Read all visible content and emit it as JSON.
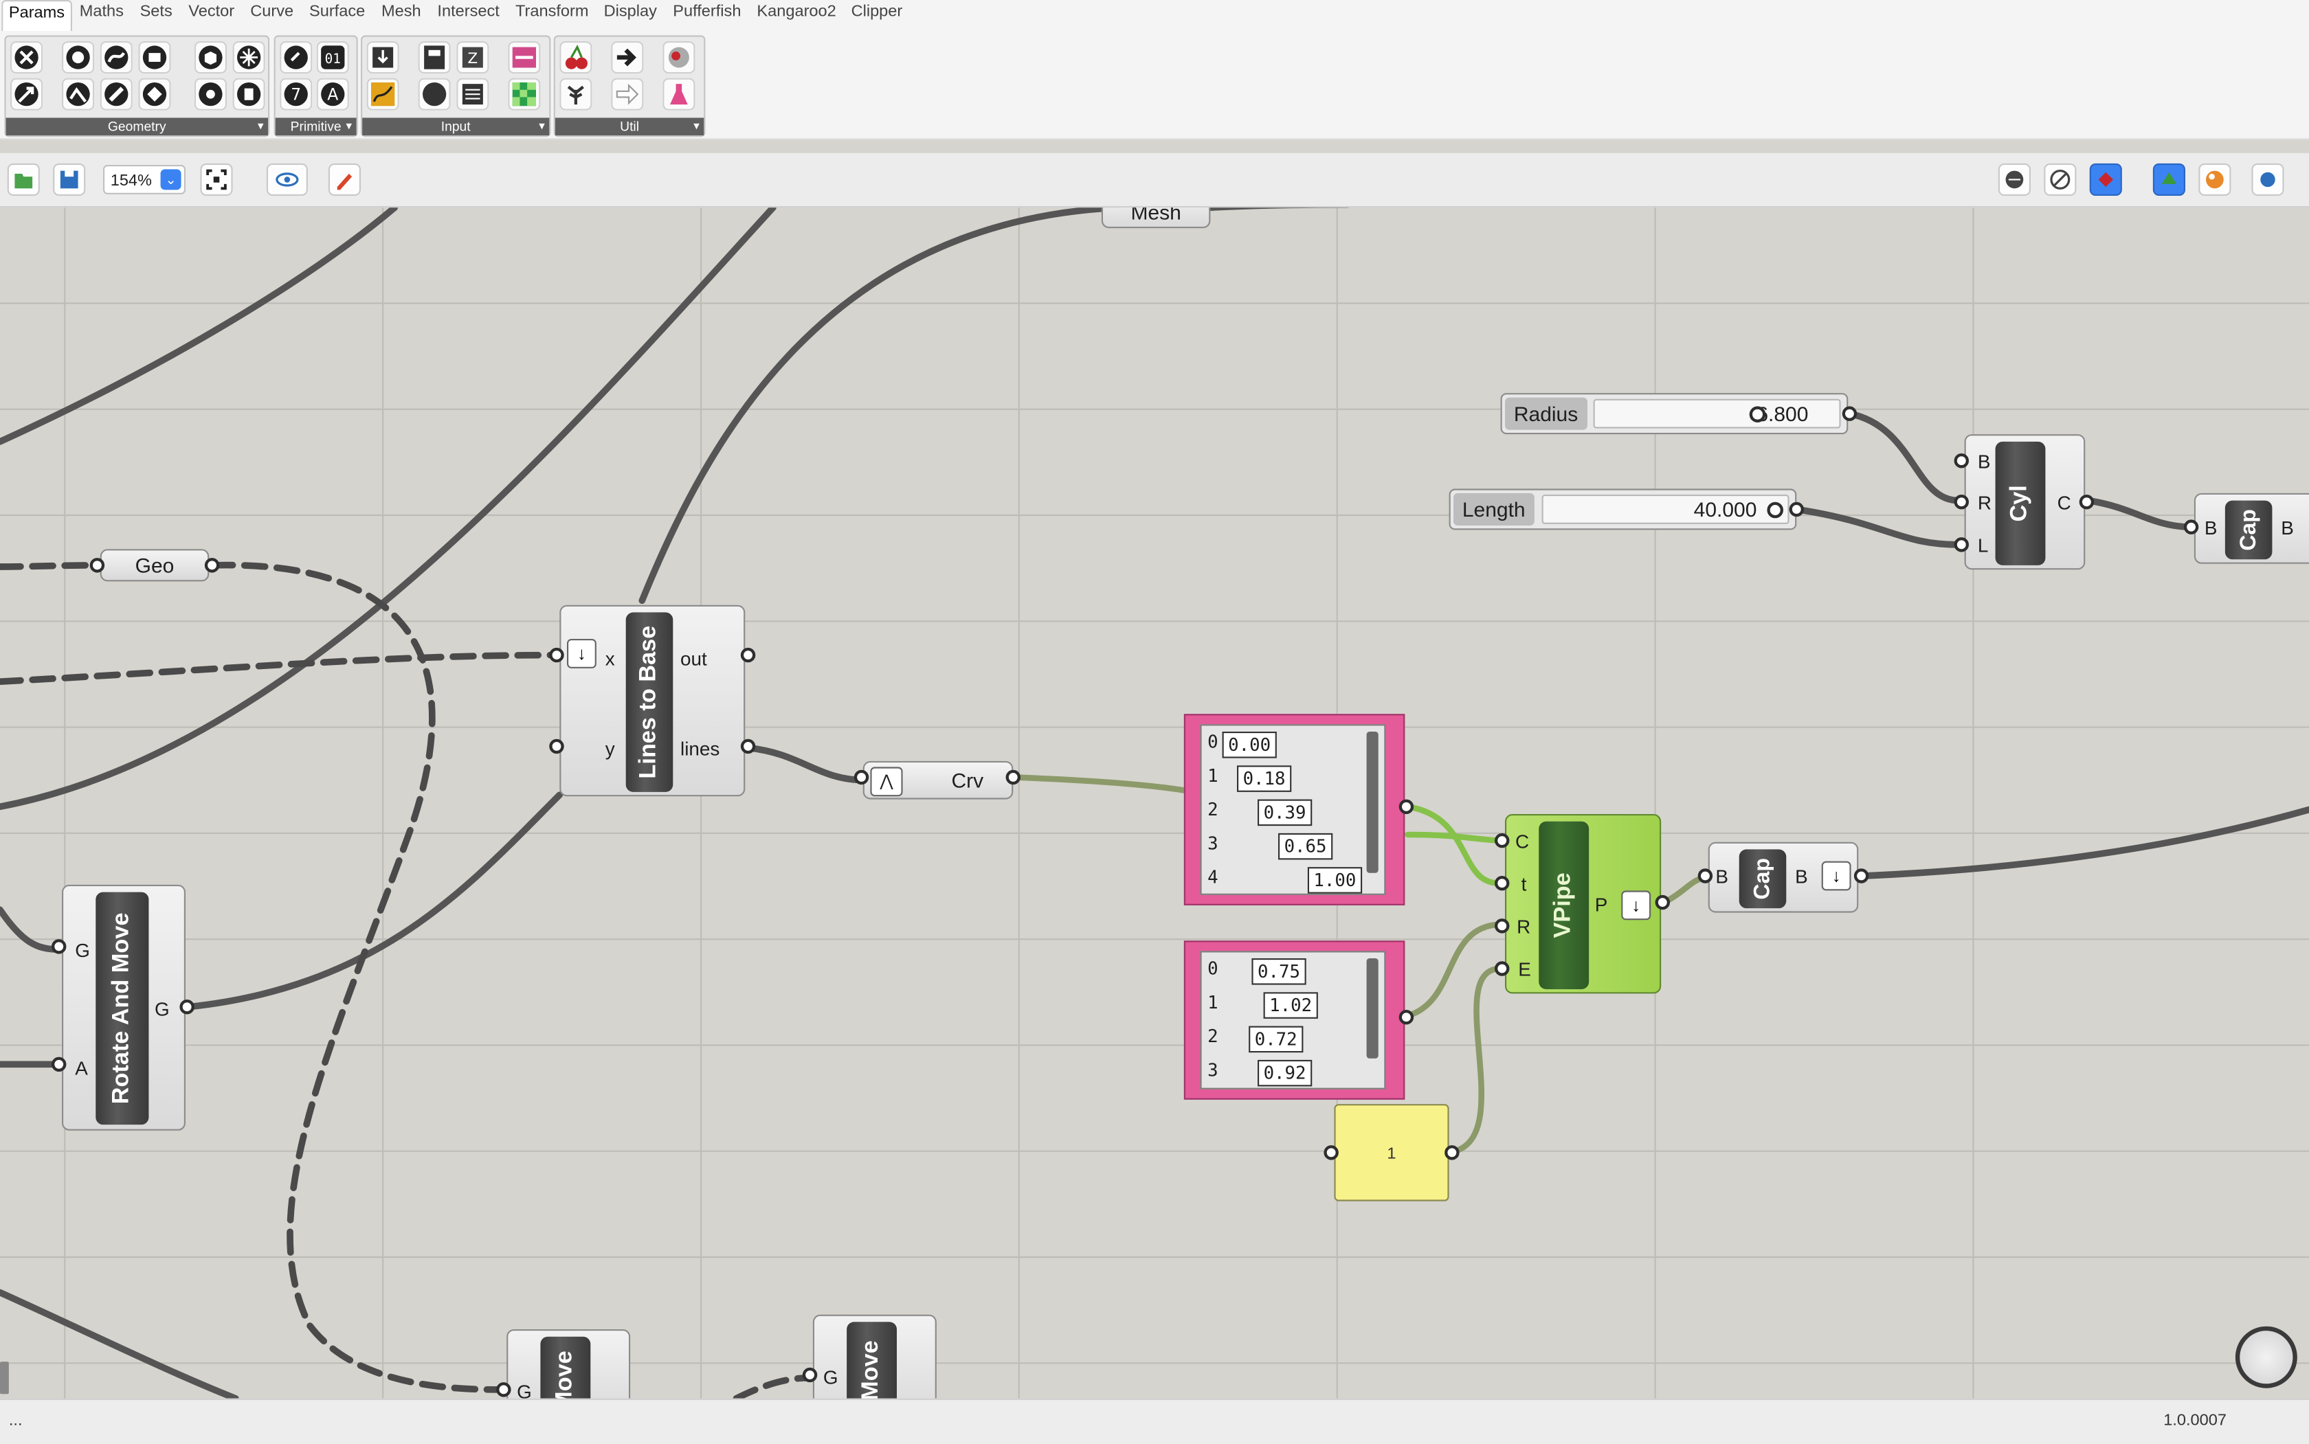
{
  "tabs": [
    "Params",
    "Maths",
    "Sets",
    "Vector",
    "Curve",
    "Surface",
    "Mesh",
    "Intersect",
    "Transform",
    "Display",
    "Pufferfish",
    "Kangaroo2",
    "Clipper"
  ],
  "active_tab": "Params",
  "ribbon_groups": [
    "Geometry",
    "Primitive",
    "Input",
    "Util"
  ],
  "toolbar": {
    "zoom": "154%"
  },
  "nodes": {
    "mesh": "Mesh",
    "geo": "Geo",
    "crv": "Crv",
    "radius": {
      "name": "Radius",
      "value": "6.800"
    },
    "length": {
      "name": "Length",
      "value": "40.000"
    },
    "cyl": {
      "title": "Cyl",
      "in": [
        "B",
        "R",
        "L"
      ],
      "out": "C"
    },
    "cap_top": {
      "title": "Cap",
      "in": "B",
      "out": "B"
    },
    "cap_mid": {
      "title": "Cap",
      "in": "B",
      "out": "B"
    },
    "lines_to_base": {
      "title": "Lines to Base",
      "in": [
        "x",
        "y"
      ],
      "out": [
        "out",
        "lines"
      ]
    },
    "rotate_move": {
      "title": "Rotate And Move",
      "in": [
        "G",
        "A"
      ],
      "out": "G"
    },
    "vpipe": {
      "title": "VPipe",
      "in": [
        "C",
        "t",
        "R",
        "E"
      ],
      "out": "P"
    },
    "move1": {
      "title": "Move",
      "in": "G"
    },
    "move2": {
      "title": "Move",
      "in": "G"
    },
    "panel_t": {
      "indices": [
        "0",
        "1",
        "2",
        "3",
        "4"
      ],
      "values": [
        "0.00",
        "0.18",
        "0.39",
        "0.65",
        "1.00"
      ]
    },
    "panel_r": {
      "indices": [
        "0",
        "1",
        "2",
        "3"
      ],
      "values": [
        "0.75",
        "1.02",
        "0.72",
        "0.92"
      ]
    },
    "number": "1"
  },
  "status": {
    "left": "...",
    "version": "1.0.0007"
  }
}
